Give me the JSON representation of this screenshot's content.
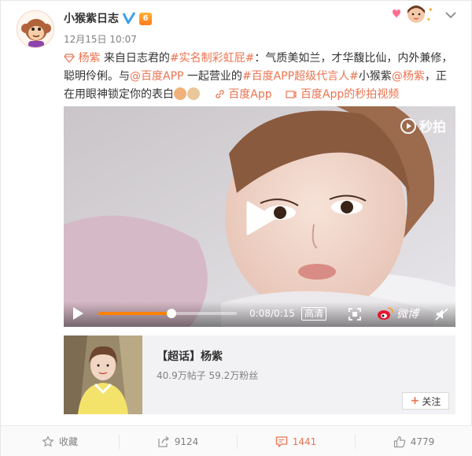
{
  "header": {
    "author": "小猴紫日志",
    "vip_badge": "6",
    "timestamp": "12月15日 10:07"
  },
  "post": {
    "mention_prefix": "杨紫",
    "text_1": " 来自日志君的",
    "hashtag_1": "#实名制彩虹屁#",
    "text_2": "：气质美如兰，才华馥比仙，内外兼修，聪明伶俐。与",
    "mention_1": "@百度APP",
    "text_3": " 一起营业的",
    "hashtag_2": "#百度APP超级代言人#",
    "text_4": "小猴紫",
    "mention_2": "@杨紫",
    "text_5": "，正在用眼神锁定你的表白",
    "link_1": "百度App",
    "link_2": "百度App的秒拍视频"
  },
  "video": {
    "watermark": "秒拍",
    "time": "0:08/0:15",
    "progress": 0.53,
    "quality": "高清",
    "brand": "微博"
  },
  "topic": {
    "title": "【超话】杨紫",
    "stats": "40.9万帖子 59.2万粉丝",
    "follow_label": "关注"
  },
  "footer": {
    "favorite_label": "收藏",
    "repost_count": "9124",
    "comment_count": "1441",
    "like_count": "4779"
  },
  "colors": {
    "accent": "#eb7350",
    "progress": "#ff8200",
    "verified": "#3aa0f0"
  }
}
